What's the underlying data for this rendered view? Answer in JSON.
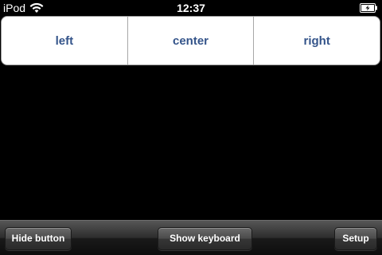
{
  "status_bar": {
    "carrier": "iPod",
    "time": "12:37",
    "wifi_icon": "wifi-icon",
    "battery_icon": "battery-charging-icon"
  },
  "segmented_control": {
    "segments": [
      {
        "label": "left"
      },
      {
        "label": "center"
      },
      {
        "label": "right"
      }
    ],
    "accent_color": "#34548a"
  },
  "toolbar": {
    "hide_label": "Hide button",
    "keyboard_label": "Show keyboard",
    "setup_label": "Setup"
  }
}
